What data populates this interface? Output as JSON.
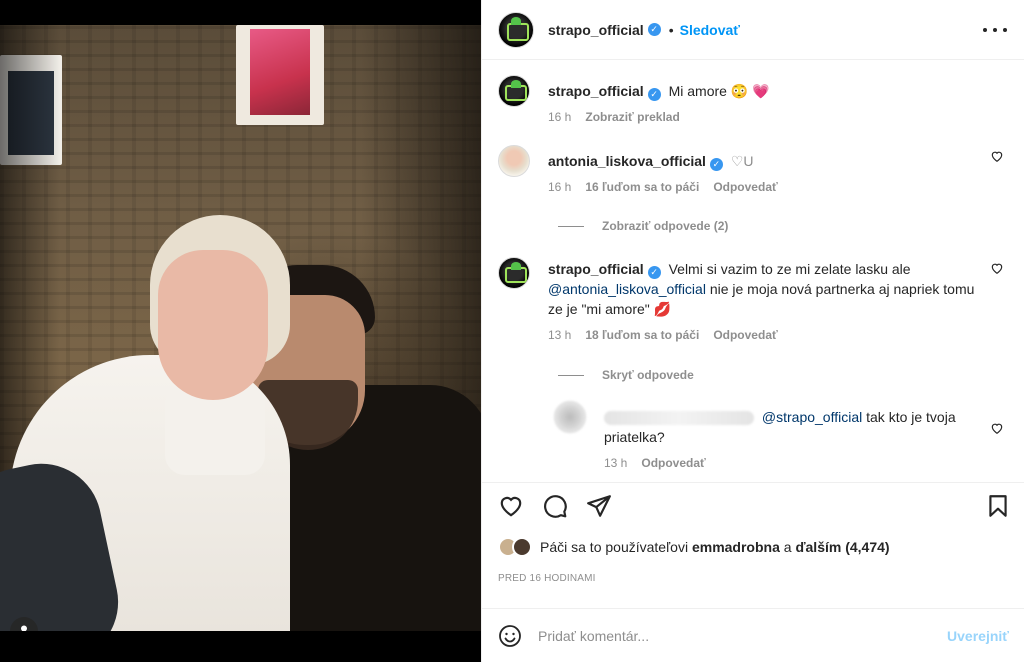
{
  "post": {
    "author": "strapo_official",
    "follow_label": "Sledovať",
    "dot": "•"
  },
  "caption": {
    "user": "strapo_official",
    "text": "Mi amore 😳 💗",
    "time": "16 h",
    "translate": "Zobraziť preklad"
  },
  "comments": [
    {
      "user": "antonia_liskova_official",
      "text": "♡U",
      "time": "16 h",
      "likes": "16 ľuďom sa to páči",
      "reply": "Odpovedať",
      "toggle": "Zobraziť odpovede (2)"
    },
    {
      "user": "strapo_official",
      "text_before": "Velmi si vazim to ze mi zelate lasku ale",
      "mention": "@antonia_liskova_official",
      "text_after": "nie je moja nová partnerka aj napriek tomu ze je \"mi amore\" 💋",
      "time": "13 h",
      "likes": "18 ľuďom sa to páči",
      "reply": "Odpovedať",
      "toggle": "Skryť odpovede"
    }
  ],
  "reply": {
    "mention": "@strapo_official",
    "text": "tak kto je tvoja priatelka?",
    "time": "13 h",
    "reply": "Odpovedať"
  },
  "likes_line": {
    "prefix": "Páči sa to používateľovi",
    "user": "emmadrobna",
    "mid": "a",
    "others": "ďalším (4,474)"
  },
  "timestamp": "PRED 16 HODINAMI",
  "add_comment": {
    "placeholder": "Pridať komentár...",
    "publish": "Uverejniť"
  }
}
